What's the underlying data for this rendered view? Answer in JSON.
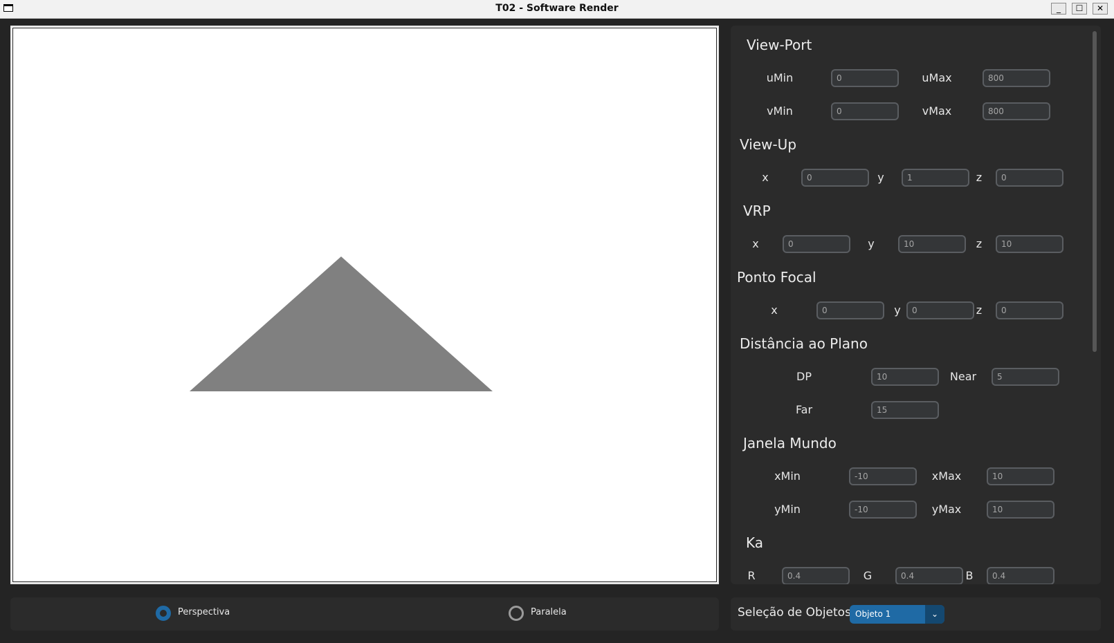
{
  "window": {
    "title": "T02 - Software Render",
    "minimize_glyph": "_",
    "maximize_glyph": "☐",
    "close_glyph": "✕"
  },
  "viewport": {
    "title": "View-Port",
    "umin_label": "uMin",
    "umin_value": "0",
    "umax_label": "uMax",
    "umax_value": "800",
    "vmin_label": "vMin",
    "vmin_value": "0",
    "vmax_label": "vMax",
    "vmax_value": "800"
  },
  "viewup": {
    "title": "View-Up",
    "x_label": "x",
    "x_value": "0",
    "y_label": "y",
    "y_value": "1",
    "z_label": "z",
    "z_value": "0"
  },
  "vrp": {
    "title": "VRP",
    "x_label": "x",
    "x_value": "0",
    "y_label": "y",
    "y_value": "10",
    "z_label": "z",
    "z_value": "10"
  },
  "focal": {
    "title": "Ponto Focal",
    "x_label": "x",
    "x_value": "0",
    "y_label": "y",
    "y_value": "0",
    "z_label": "z",
    "z_value": "0"
  },
  "distance": {
    "title": "Distância ao Plano",
    "dp_label": "DP",
    "dp_value": "10",
    "near_label": "Near",
    "near_value": "5",
    "far_label": "Far",
    "far_value": "15"
  },
  "world_window": {
    "title": "Janela Mundo",
    "xmin_label": "xMin",
    "xmin_value": "-10",
    "xmax_label": "xMax",
    "xmax_value": "10",
    "ymin_label": "yMin",
    "ymin_value": "-10",
    "ymax_label": "yMax",
    "ymax_value": "10"
  },
  "ka": {
    "title": "Ka",
    "r_label": "R",
    "r_value": "0.4",
    "g_label": "G",
    "g_value": "0.4",
    "b_label": "B",
    "b_value": "0.4"
  },
  "projection": {
    "perspective_label": "Perspectiva",
    "parallel_label": "Paralela",
    "selected": "Perspectiva"
  },
  "object_selection": {
    "label": "Seleção de Objetos",
    "selected": "Objeto 1"
  },
  "colors": {
    "accent": "#1f6aa5",
    "triangle_fill": "#808080",
    "panel_bg": "#2b2b2b"
  },
  "icons": {
    "app": "window-icon",
    "dropdown": "chevron-down-icon"
  }
}
